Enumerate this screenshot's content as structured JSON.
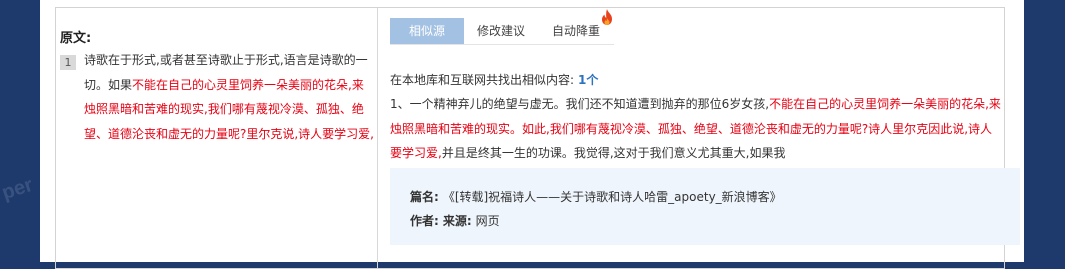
{
  "watermark": "per",
  "left": {
    "heading": "原文:",
    "paragraph_number": "1",
    "text_plain": "诗歌在于形式,或者甚至诗歌止于形式,语言是诗歌的一切。如果",
    "text_highlight": "不能在自己的心灵里饲养一朵美丽的花朵,来烛照黑暗和苦难的现实,我们哪有蔑视冷漠、孤独、绝望、道德沦丧和虚无的力量呢?里尔克说,诗人要学习爱,"
  },
  "tabs": [
    {
      "label": "相似源",
      "active": true
    },
    {
      "label": "修改建议",
      "active": false
    },
    {
      "label": "自动降重",
      "active": false
    }
  ],
  "icons": {
    "hot": "fire-icon"
  },
  "colors": {
    "highlight": "#e60012",
    "active_tab": "#a3c1e3",
    "count": "#2b72c1"
  },
  "right": {
    "summary_label": "在本地库和互联网共找出相似内容:",
    "summary_count": "1个",
    "match_plain_1": "1、一个精神弃儿的绝望与虚无。我们还不知道遭到抛弃的那位6岁女孩,",
    "match_highlight": "不能在自己的心灵里饲养一朵美丽的花朵,来烛照黑暗和苦难的现实。如此,我们哪有蔑视冷漠、孤独、绝望、道德沦丧和虚无的力量呢?诗人里尔克因此说,诗人要学习爱,",
    "match_plain_2": "并且是终其一生的功课。我觉得,这对于我们意义尤其重大,如果我",
    "source": {
      "title_label": "篇名:",
      "title_value": "《[转载]祝福诗人——关于诗歌和诗人哈雷_apoety_新浪博客》",
      "author_label": "作者:",
      "origin_label": "来源:",
      "origin_value": "网页"
    }
  }
}
